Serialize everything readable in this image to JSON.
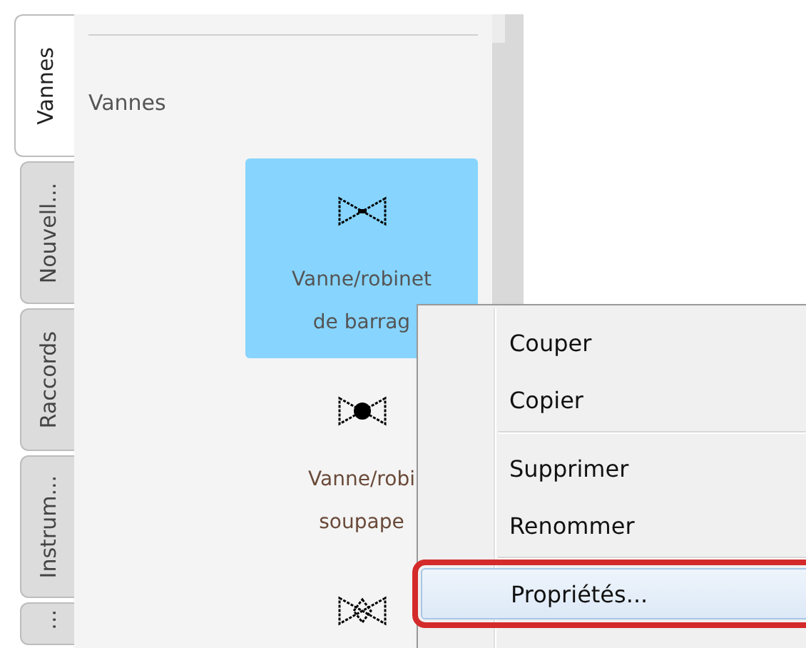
{
  "tabs": [
    {
      "label": "Vannes",
      "selected": true
    },
    {
      "label": "Nouvell...",
      "selected": false
    },
    {
      "label": "Raccords",
      "selected": false
    },
    {
      "label": "Instrum...",
      "selected": false
    },
    {
      "label": "...",
      "selected": false
    }
  ],
  "panel": {
    "heading": "Vannes",
    "items": [
      {
        "kind": "gate",
        "label_lines": [
          "Vanne/robinet",
          "de barrag"
        ],
        "selected": true
      },
      {
        "kind": "globe",
        "label_lines": [
          "Vanne/robi",
          "soupape"
        ],
        "selected": false
      },
      {
        "kind": "diamond",
        "selected": false
      }
    ]
  },
  "context_menu": {
    "items": [
      {
        "kind": "item",
        "label": "Couper",
        "selected": false,
        "annotated": false
      },
      {
        "kind": "item",
        "label": "Copier",
        "selected": false,
        "annotated": false
      },
      {
        "kind": "separator"
      },
      {
        "kind": "item",
        "label": "Supprimer",
        "selected": false,
        "annotated": false
      },
      {
        "kind": "item",
        "label": "Renommer",
        "selected": false,
        "annotated": false
      },
      {
        "kind": "separator"
      },
      {
        "kind": "item",
        "label": "Propriétés...",
        "selected": true,
        "annotated": true
      }
    ]
  }
}
